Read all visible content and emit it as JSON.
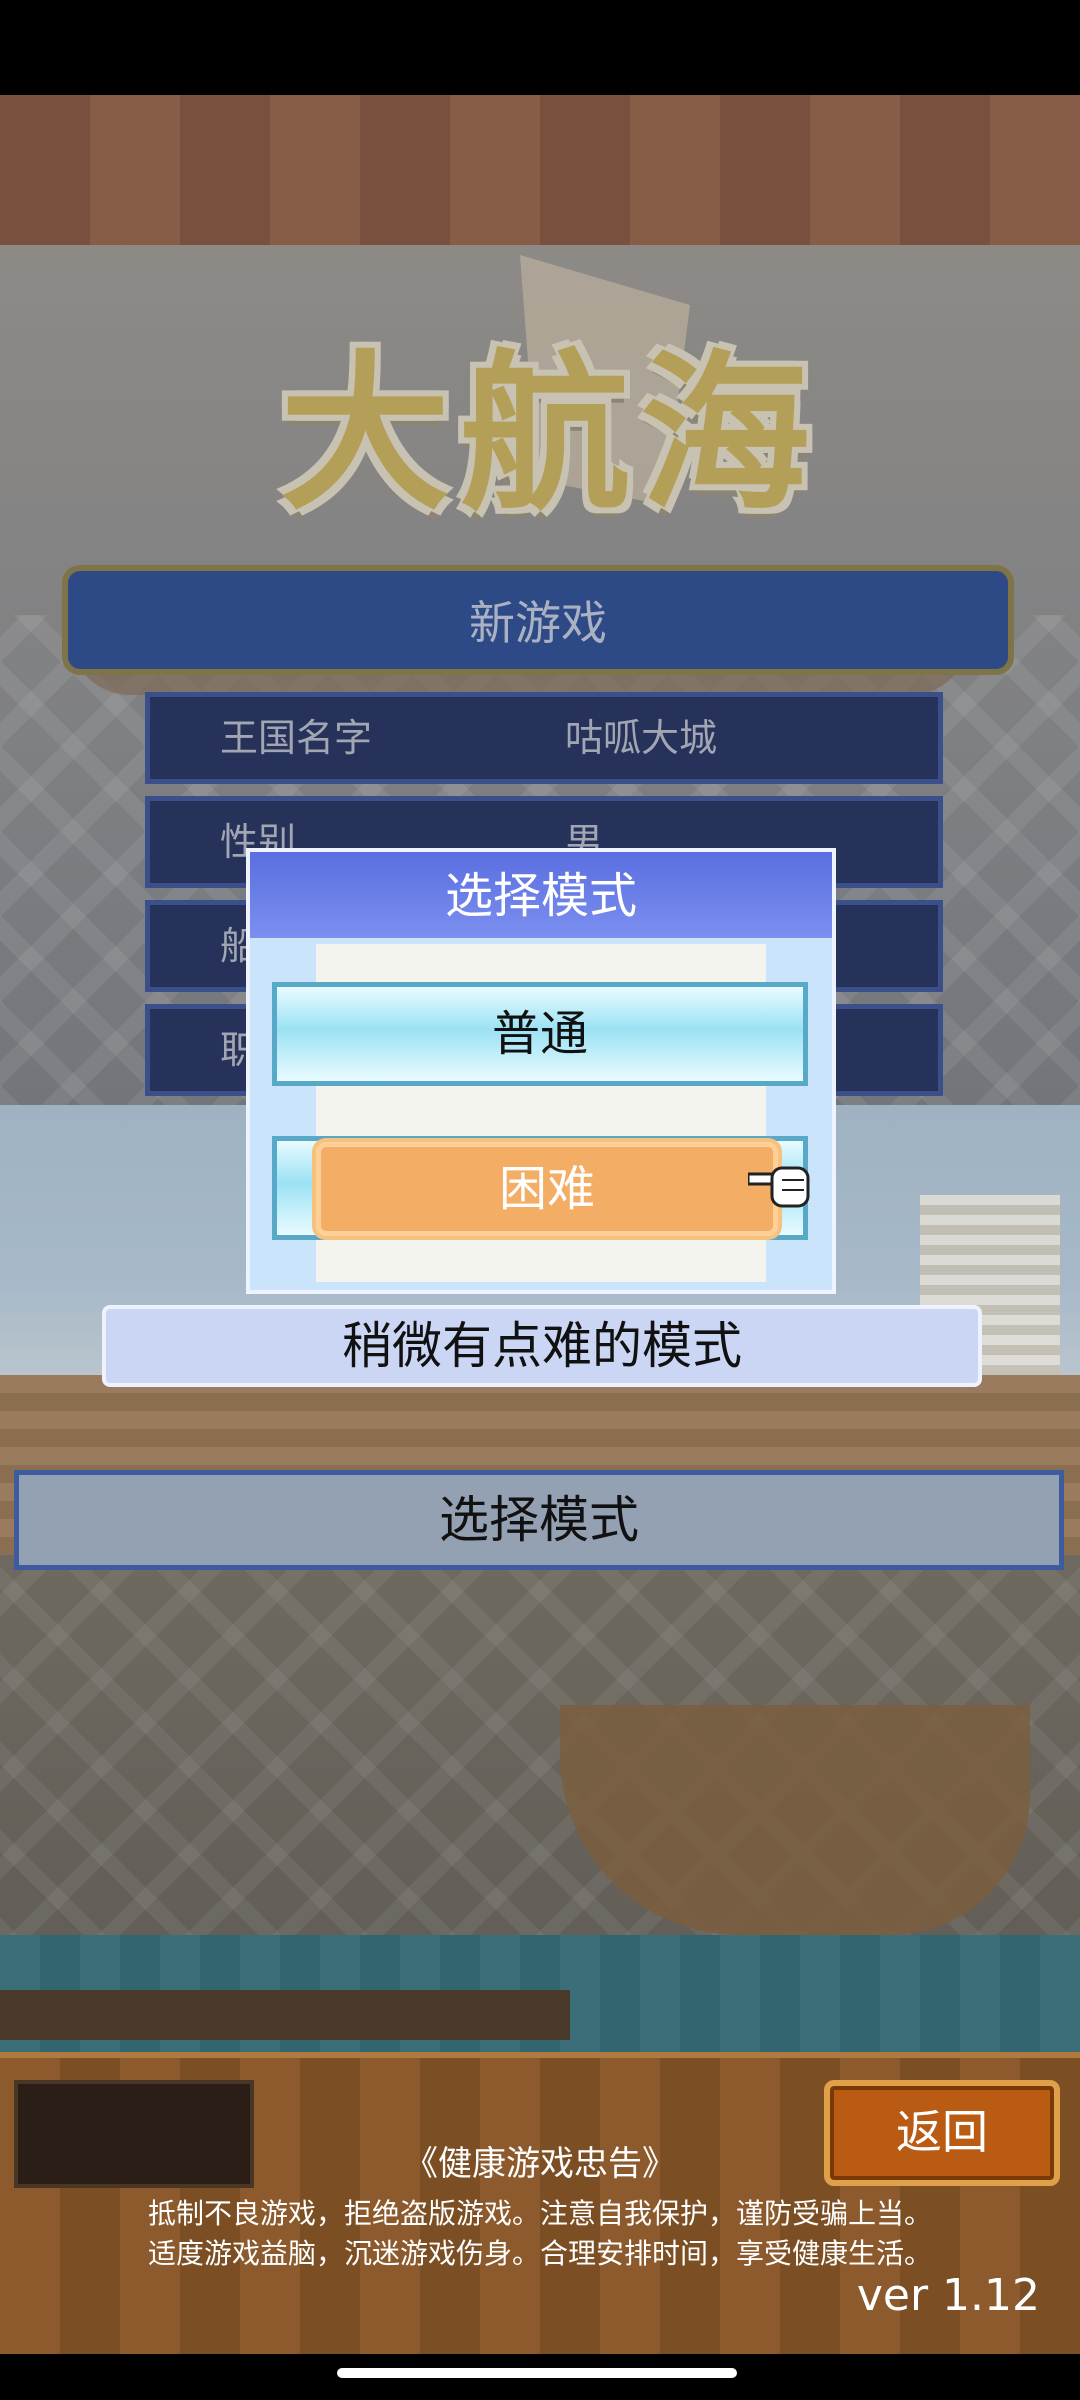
{
  "logo": {
    "text": "大航海"
  },
  "new_game": {
    "title": "新游戏",
    "fields": [
      {
        "label": "王国名字",
        "value": "咕呱大城"
      },
      {
        "label": "性别",
        "value": "男"
      },
      {
        "label": "船",
        "value": ""
      },
      {
        "label": "职",
        "value": ""
      }
    ]
  },
  "mode_dialog": {
    "title": "选择模式",
    "options": [
      {
        "label": "普通"
      },
      {
        "label": "困难"
      }
    ],
    "selected": "困难"
  },
  "description": "稍微有点难的模式",
  "instruction": "选择模式",
  "footer": {
    "back_label": "返回",
    "advisory_title": "《健康游戏忠告》",
    "advisory_lines": [
      "抵制不良游戏，拒绝盗版游戏。注意自我保护，谨防受骗上当。",
      "适度游戏益脑，沉迷游戏伤身。合理安排时间，享受健康生活。"
    ],
    "version": "ver 1.12"
  },
  "icons": {
    "pointer": "pointing-hand-icon"
  },
  "colors": {
    "highlight": "#f3ad64",
    "dialog_header": "#5a6ee0",
    "back_button": "#b95b12"
  }
}
